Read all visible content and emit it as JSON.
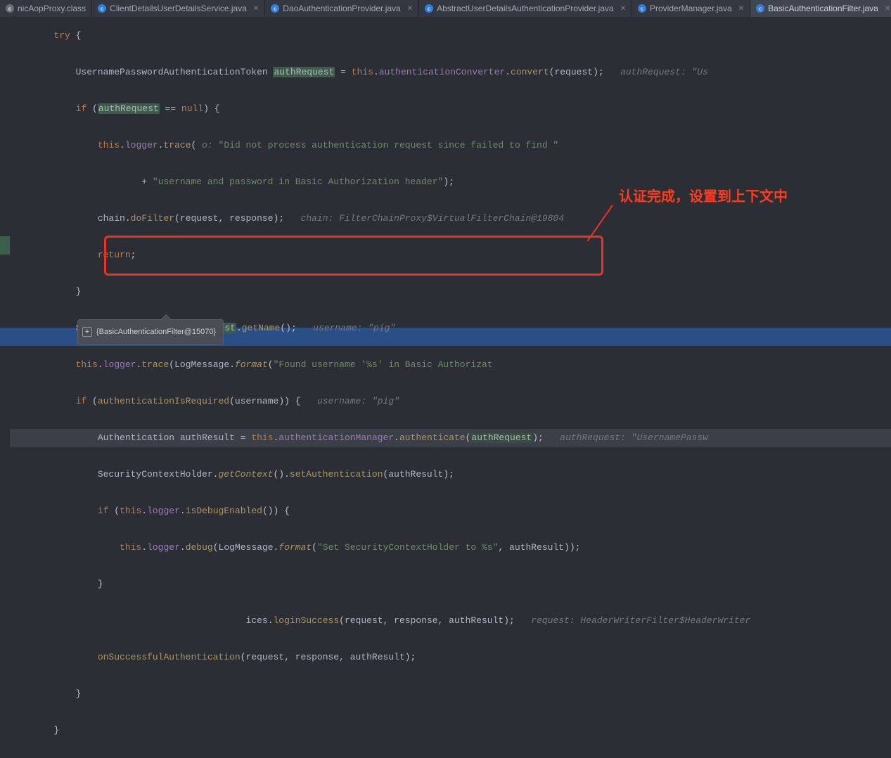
{
  "tabs": [
    {
      "label": "nicAopProxy.class",
      "icon": "gray",
      "close": false
    },
    {
      "label": "ClientDetailsUserDetailsService.java",
      "icon": "blue",
      "close": true
    },
    {
      "label": "DaoAuthenticationProvider.java",
      "icon": "blue",
      "close": true
    },
    {
      "label": "AbstractUserDetailsAuthenticationProvider.java",
      "icon": "blue",
      "close": true
    },
    {
      "label": "ProviderManager.java",
      "icon": "blue",
      "close": true
    },
    {
      "label": "BasicAuthenticationFilter.java",
      "icon": "blue",
      "close": true,
      "active": true
    }
  ],
  "code": {
    "l1_try": "try",
    "l2_type": "UsernamePasswordAuthenticationToken",
    "l2_var": "authRequest",
    "l2_this": "this",
    "l2_fld": "authenticationConverter",
    "l2_m": "convert",
    "l2_p": "request",
    "l2_cmt": "authRequest: \"Us",
    "l3_if": "if",
    "l3_var": "authRequest",
    "l3_null": "null",
    "l4_this": "this",
    "l4_log": "logger",
    "l4_m": "trace",
    "l4_prm": "o:",
    "l4_s": "\"Did not process authentication request since failed to find \"",
    "l5_s": "\"username and password in Basic Authorization header\"",
    "l6_chain": "chain",
    "l6_m": "doFilter",
    "l6_p": "request, response",
    "l6_cmt": "chain: FilterChainProxy$VirtualFilterChain@19804",
    "l7_ret": "return",
    "l9_str": "String",
    "l9_var": "username",
    "l9_ar": "authRequest",
    "l9_m": "getName",
    "l9_cmt": "username: \"pig\"",
    "l10_this": "this",
    "l10_log": "logger",
    "l10_m": "trace",
    "l10_cls": "LogMessage",
    "l10_fmt": "format",
    "l10_s": "\"Found username '%s' in Basic Authorizat",
    "l11_if": "if",
    "l11_m": "authenticationIsRequired",
    "l11_p": "username",
    "l11_cmt": "username: \"pig\"",
    "l12_type": "Authentication",
    "l12_var": "authResult",
    "l12_this": "this",
    "l12_fld": "authenticationManager",
    "l12_m": "authenticate",
    "l12_p": "authRequest",
    "l12_cmt": "authRequest: \"UsernamePassw",
    "l13_cls": "SecurityContextHolder",
    "l13_m1": "getContext",
    "l13_m2": "setAuthentication",
    "l13_p": "authResult",
    "l14_if": "if",
    "l14_this": "this",
    "l14_log": "logger",
    "l14_m": "isDebugEnabled",
    "l15_this": "this",
    "l15_log": "logger",
    "l15_m": "debug",
    "l15_cls": "LogMessage",
    "l15_fmt": "format",
    "l15_s": "\"Set SecurityContextHolder to %s\"",
    "l15_p": "authResult",
    "l17_ices": "ices",
    "l17_m": "loginSuccess",
    "l17_p": "request, response, authResult",
    "l17_cmt": "request: HeaderWriterFilter$HeaderWriter",
    "l18_m": "onSuccessfulAuthentication",
    "l18_p": "request, response, authResult"
  },
  "annotation": {
    "text": "认证完成，设置到上下文中"
  },
  "tooltip": {
    "text": "{BasicAuthenticationFilter@15070}"
  }
}
